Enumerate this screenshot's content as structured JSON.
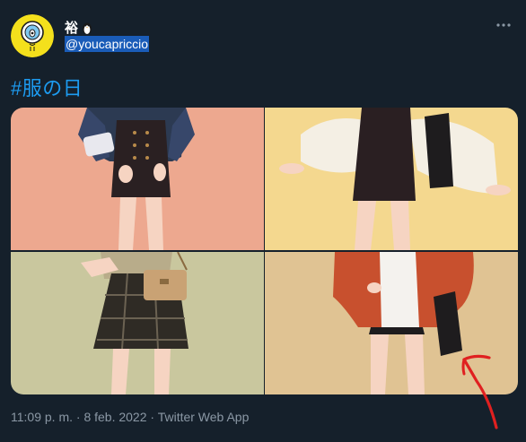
{
  "author": {
    "display_name": "裕",
    "handle": "@youcapriccio"
  },
  "tweet": {
    "hashtag": "#服の日",
    "timestamp": "11:09 p. m. · 8 feb. 2022 · Twitter Web App"
  },
  "media": {
    "photos": [
      {
        "subject": "dark navy blouse with black corset skirt",
        "background": "#eda88f"
      },
      {
        "subject": "white puff-sleeve blouse with black pinafore dress and backpack",
        "background": "#f4d88f"
      },
      {
        "subject": "beige top with plaid skirt and tan crossbody bag",
        "background": "#c9c79e"
      },
      {
        "subject": "orange jacket over white top and black skirt",
        "background": "#e0c393"
      }
    ]
  },
  "colors": {
    "background": "#15202b",
    "link": "#1d9bf0",
    "muted": "#8b98a5",
    "handle_highlight": "#1a5cb8",
    "annotation": "#e02020"
  },
  "icons": {
    "more": "more-horizontal-icon",
    "name_emoji": "penguin-icon",
    "avatar": "cartoon-bird-avatar"
  }
}
